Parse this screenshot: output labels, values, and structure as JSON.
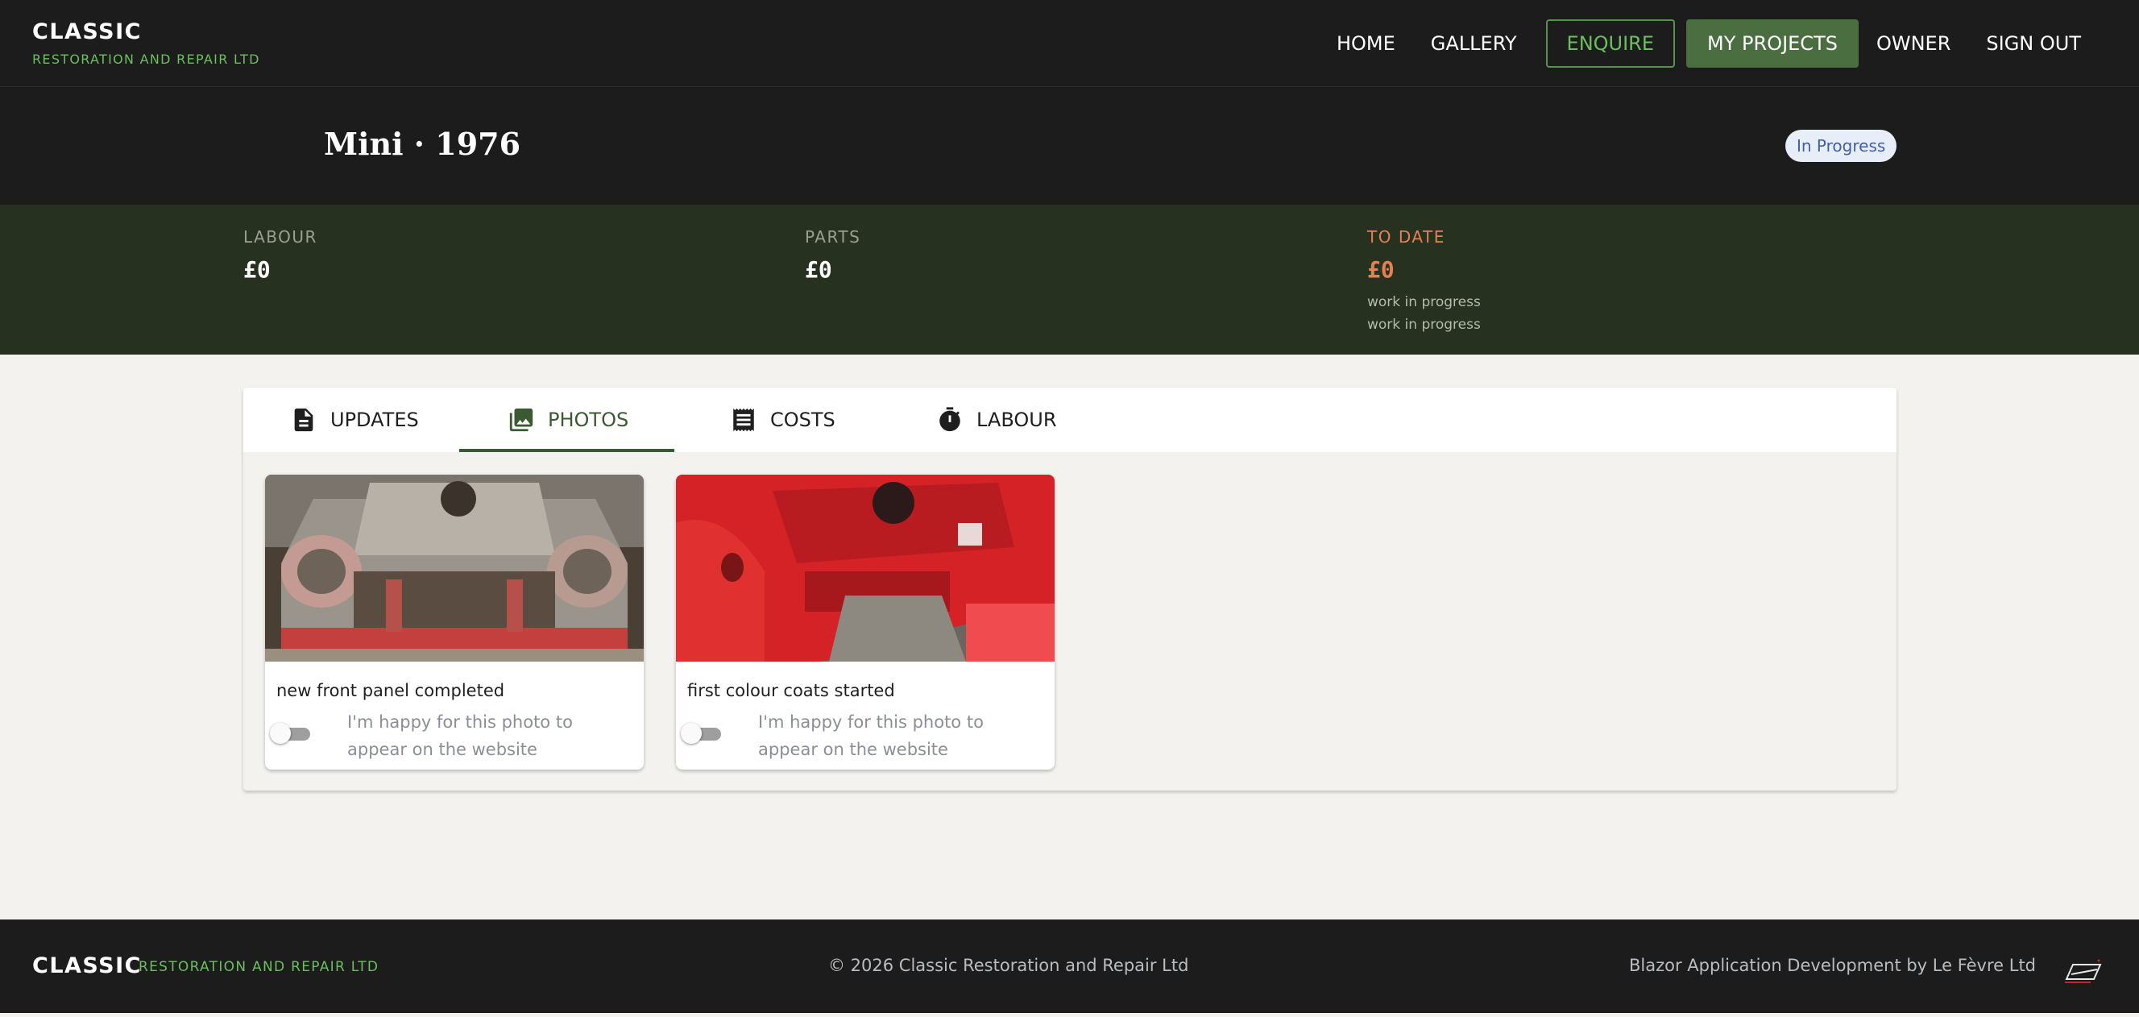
{
  "brand": {
    "name": "CLASSIC",
    "sub": "RESTORATION AND REPAIR LTD"
  },
  "nav": {
    "home": "HOME",
    "gallery": "GALLERY",
    "enquire": "ENQUIRE",
    "my_projects": "MY PROJECTS",
    "owner": "OWNER",
    "sign_out": "SIGN OUT"
  },
  "project": {
    "title": "Mini · 1976",
    "status": "In Progress"
  },
  "costs": {
    "labour": {
      "label": "LABOUR",
      "value": "£0"
    },
    "parts": {
      "label": "PARTS",
      "value": "£0"
    },
    "to_date": {
      "label": "TO DATE",
      "value": "£0",
      "notes": [
        "work in progress",
        "work in progress"
      ]
    }
  },
  "tabs": [
    {
      "label": "UPDATES",
      "icon": "document-icon"
    },
    {
      "label": "PHOTOS",
      "icon": "photo-library-icon",
      "active": true
    },
    {
      "label": "COSTS",
      "icon": "receipt-icon"
    },
    {
      "label": "LABOUR",
      "icon": "timer-icon"
    }
  ],
  "photos": [
    {
      "caption": "new front panel completed",
      "toggle_label": "I'm happy for this photo to appear on the website",
      "published": false
    },
    {
      "caption": "first colour coats started",
      "toggle_label": "I'm happy for this photo to appear on the website",
      "published": false
    }
  ],
  "footer": {
    "brand": "CLASSIC",
    "sub": "RESTORATION AND REPAIR LTD",
    "copyright": "© 2026 Classic Restoration and Repair Ltd",
    "credit": "Blazor Application Development by Le Fèvre Ltd"
  },
  "colors": {
    "accent_green": "#6cbf5f",
    "dark": "#1c1c1c",
    "band": "#26321f",
    "to_date": "#e58053",
    "active_tab": "#3c5a31"
  }
}
